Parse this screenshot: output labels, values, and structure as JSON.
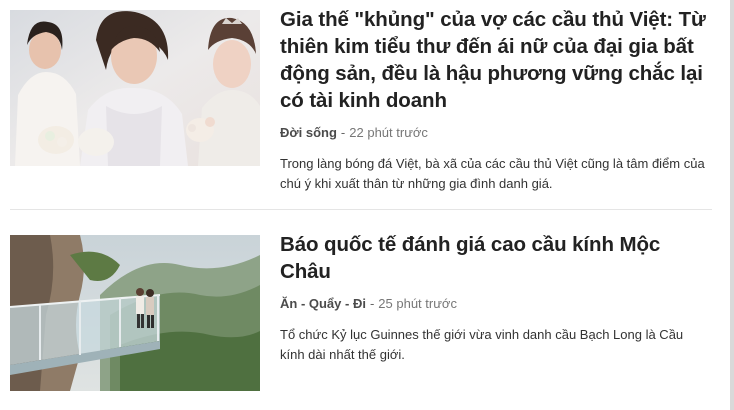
{
  "articles": [
    {
      "title": "Gia thế \"khủng\" của vợ các cầu thủ Việt: Từ thiên kim tiểu thư đến ái nữ của đại gia bất động sản, đều là hậu phương vững chắc lại có tài kinh doanh",
      "category": "Đời sống",
      "separator": "-",
      "time": "22 phút trước",
      "summary": "Trong làng bóng đá Việt, bà xã của các cầu thủ Việt cũng là tâm điểm của chú ý khi xuất thân từ những gia đình danh giá."
    },
    {
      "title": "Báo quốc tế đánh giá cao cầu kính Mộc Châu",
      "category": "Ăn - Quẩy - Đi",
      "separator": "-",
      "time": "25 phút trước",
      "summary": "Tổ chức Kỷ lục Guinnes thế giới vừa vinh danh cầu Bạch Long là Cầu kính dài nhất thế giới."
    }
  ],
  "colors": {
    "title": "#222222",
    "category": "#4b4b4b",
    "time": "#777777",
    "divider": "#e5e5e5"
  }
}
